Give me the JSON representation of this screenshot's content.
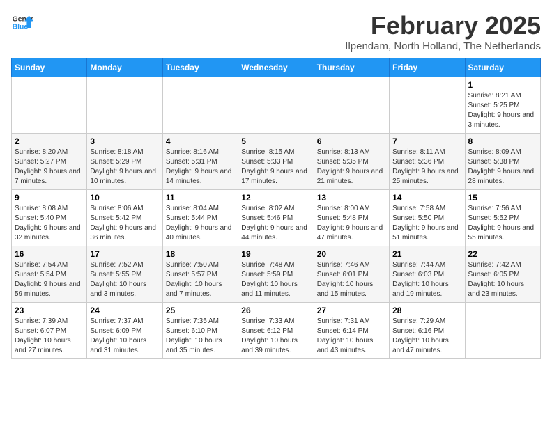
{
  "header": {
    "logo_line1": "General",
    "logo_line2": "Blue",
    "month_year": "February 2025",
    "location": "Ilpendam, North Holland, The Netherlands"
  },
  "days_of_week": [
    "Sunday",
    "Monday",
    "Tuesday",
    "Wednesday",
    "Thursday",
    "Friday",
    "Saturday"
  ],
  "weeks": [
    [
      {
        "day": "",
        "info": ""
      },
      {
        "day": "",
        "info": ""
      },
      {
        "day": "",
        "info": ""
      },
      {
        "day": "",
        "info": ""
      },
      {
        "day": "",
        "info": ""
      },
      {
        "day": "",
        "info": ""
      },
      {
        "day": "1",
        "info": "Sunrise: 8:21 AM\nSunset: 5:25 PM\nDaylight: 9 hours and 3 minutes."
      }
    ],
    [
      {
        "day": "2",
        "info": "Sunrise: 8:20 AM\nSunset: 5:27 PM\nDaylight: 9 hours and 7 minutes."
      },
      {
        "day": "3",
        "info": "Sunrise: 8:18 AM\nSunset: 5:29 PM\nDaylight: 9 hours and 10 minutes."
      },
      {
        "day": "4",
        "info": "Sunrise: 8:16 AM\nSunset: 5:31 PM\nDaylight: 9 hours and 14 minutes."
      },
      {
        "day": "5",
        "info": "Sunrise: 8:15 AM\nSunset: 5:33 PM\nDaylight: 9 hours and 17 minutes."
      },
      {
        "day": "6",
        "info": "Sunrise: 8:13 AM\nSunset: 5:35 PM\nDaylight: 9 hours and 21 minutes."
      },
      {
        "day": "7",
        "info": "Sunrise: 8:11 AM\nSunset: 5:36 PM\nDaylight: 9 hours and 25 minutes."
      },
      {
        "day": "8",
        "info": "Sunrise: 8:09 AM\nSunset: 5:38 PM\nDaylight: 9 hours and 28 minutes."
      }
    ],
    [
      {
        "day": "9",
        "info": "Sunrise: 8:08 AM\nSunset: 5:40 PM\nDaylight: 9 hours and 32 minutes."
      },
      {
        "day": "10",
        "info": "Sunrise: 8:06 AM\nSunset: 5:42 PM\nDaylight: 9 hours and 36 minutes."
      },
      {
        "day": "11",
        "info": "Sunrise: 8:04 AM\nSunset: 5:44 PM\nDaylight: 9 hours and 40 minutes."
      },
      {
        "day": "12",
        "info": "Sunrise: 8:02 AM\nSunset: 5:46 PM\nDaylight: 9 hours and 44 minutes."
      },
      {
        "day": "13",
        "info": "Sunrise: 8:00 AM\nSunset: 5:48 PM\nDaylight: 9 hours and 47 minutes."
      },
      {
        "day": "14",
        "info": "Sunrise: 7:58 AM\nSunset: 5:50 PM\nDaylight: 9 hours and 51 minutes."
      },
      {
        "day": "15",
        "info": "Sunrise: 7:56 AM\nSunset: 5:52 PM\nDaylight: 9 hours and 55 minutes."
      }
    ],
    [
      {
        "day": "16",
        "info": "Sunrise: 7:54 AM\nSunset: 5:54 PM\nDaylight: 9 hours and 59 minutes."
      },
      {
        "day": "17",
        "info": "Sunrise: 7:52 AM\nSunset: 5:55 PM\nDaylight: 10 hours and 3 minutes."
      },
      {
        "day": "18",
        "info": "Sunrise: 7:50 AM\nSunset: 5:57 PM\nDaylight: 10 hours and 7 minutes."
      },
      {
        "day": "19",
        "info": "Sunrise: 7:48 AM\nSunset: 5:59 PM\nDaylight: 10 hours and 11 minutes."
      },
      {
        "day": "20",
        "info": "Sunrise: 7:46 AM\nSunset: 6:01 PM\nDaylight: 10 hours and 15 minutes."
      },
      {
        "day": "21",
        "info": "Sunrise: 7:44 AM\nSunset: 6:03 PM\nDaylight: 10 hours and 19 minutes."
      },
      {
        "day": "22",
        "info": "Sunrise: 7:42 AM\nSunset: 6:05 PM\nDaylight: 10 hours and 23 minutes."
      }
    ],
    [
      {
        "day": "23",
        "info": "Sunrise: 7:39 AM\nSunset: 6:07 PM\nDaylight: 10 hours and 27 minutes."
      },
      {
        "day": "24",
        "info": "Sunrise: 7:37 AM\nSunset: 6:09 PM\nDaylight: 10 hours and 31 minutes."
      },
      {
        "day": "25",
        "info": "Sunrise: 7:35 AM\nSunset: 6:10 PM\nDaylight: 10 hours and 35 minutes."
      },
      {
        "day": "26",
        "info": "Sunrise: 7:33 AM\nSunset: 6:12 PM\nDaylight: 10 hours and 39 minutes."
      },
      {
        "day": "27",
        "info": "Sunrise: 7:31 AM\nSunset: 6:14 PM\nDaylight: 10 hours and 43 minutes."
      },
      {
        "day": "28",
        "info": "Sunrise: 7:29 AM\nSunset: 6:16 PM\nDaylight: 10 hours and 47 minutes."
      },
      {
        "day": "",
        "info": ""
      }
    ]
  ]
}
